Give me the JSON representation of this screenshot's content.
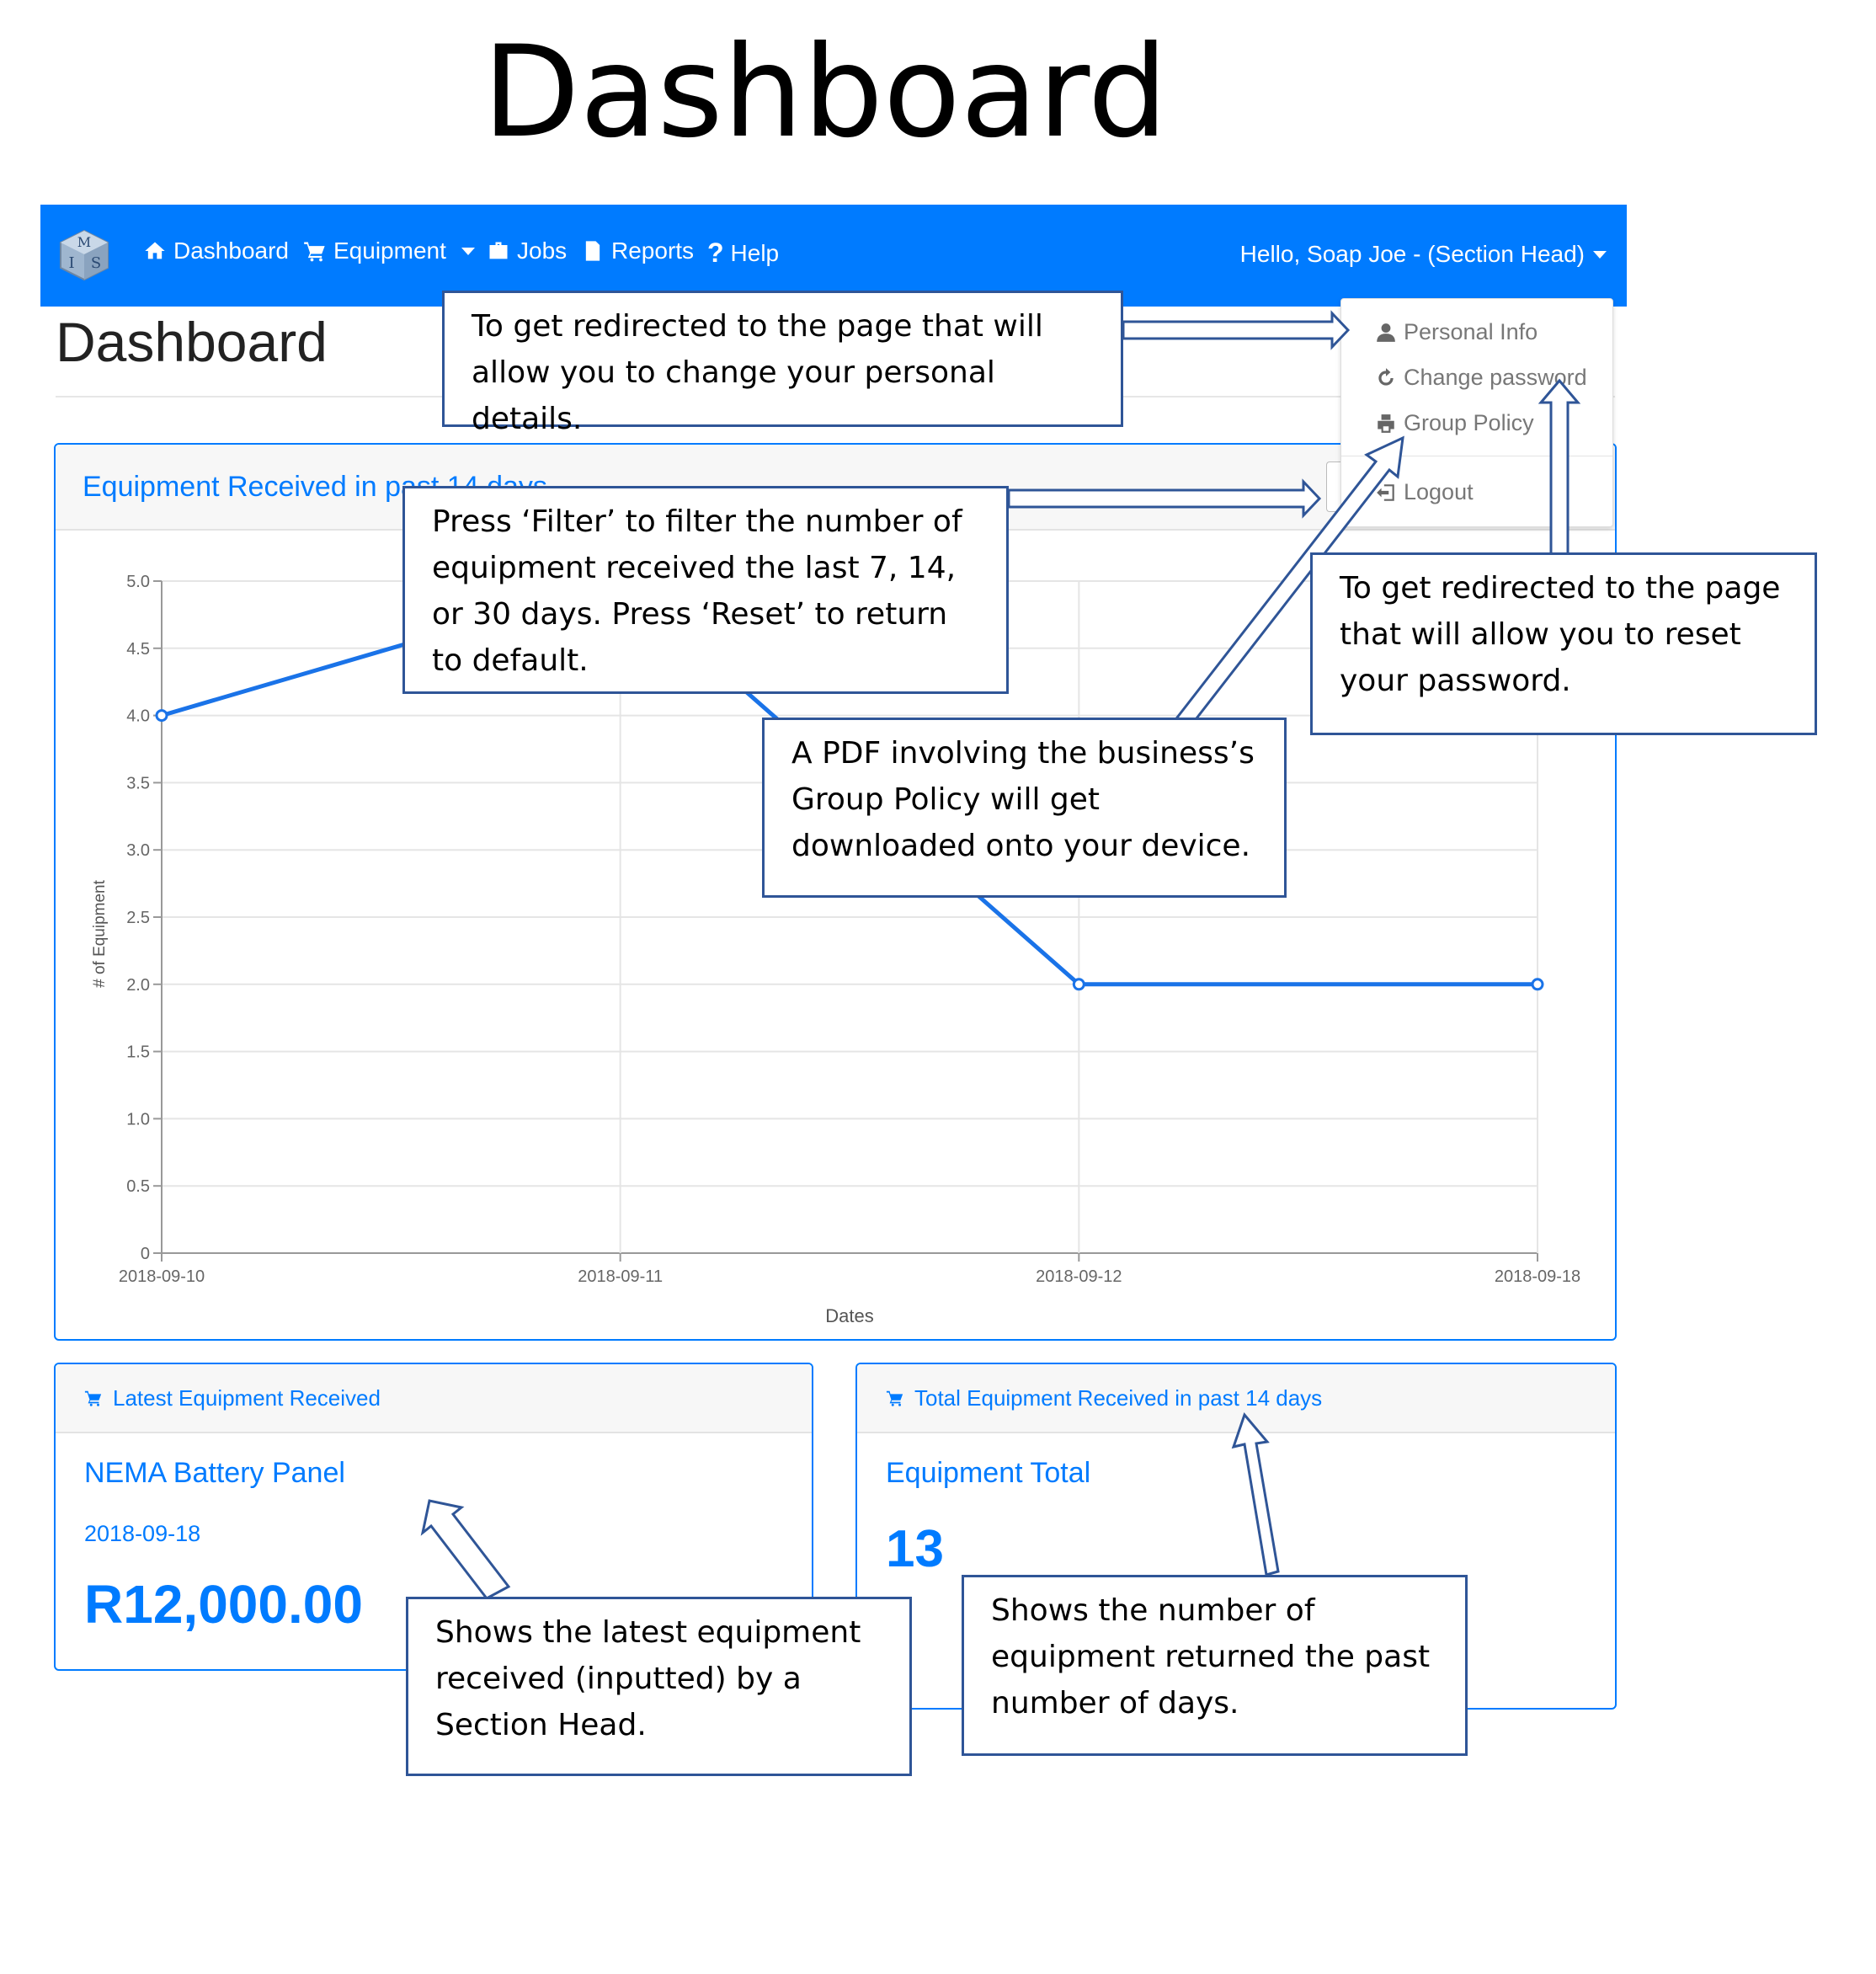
{
  "document_title": "Dashboard",
  "navbar": {
    "logo_letters": [
      "M",
      "I",
      "S"
    ],
    "items": [
      {
        "label": "Dashboard",
        "icon": "home-icon"
      },
      {
        "label": "Equipment",
        "icon": "cart-icon"
      },
      {
        "label": "Jobs",
        "icon": "briefcase-icon"
      },
      {
        "label": "Reports",
        "icon": "report-icon"
      },
      {
        "label": "Help",
        "icon": "question-icon"
      }
    ],
    "user_greeting": "Hello, Soap Joe - (Section Head)",
    "color": "#007bff"
  },
  "page": {
    "heading": "Dashboard"
  },
  "user_dropdown": {
    "items": [
      {
        "label": "Personal Info",
        "icon": "user-icon"
      },
      {
        "label": "Change password",
        "icon": "refresh-icon"
      },
      {
        "label": "Group Policy",
        "icon": "print-icon"
      },
      {
        "label": "Logout",
        "icon": "logout-icon"
      }
    ]
  },
  "equipment_chart": {
    "header": "Equipment Received in past 14 days"
  },
  "chart_data": {
    "type": "line",
    "categories": [
      "2018-09-10",
      "2018-09-11",
      "2018-09-12",
      "2018-09-18"
    ],
    "series": [
      {
        "values": [
          4,
          5,
          2,
          2
        ]
      }
    ],
    "ylim": [
      0,
      5
    ],
    "yticks": [
      "0",
      "0.5",
      "1.0",
      "1.5",
      "2.0",
      "2.5",
      "3.0",
      "3.5",
      "4.0",
      "4.5",
      "5.0"
    ],
    "xlabel": "Dates",
    "ylabel": "# of Equipment",
    "grid": true,
    "color": "#1a73e8"
  },
  "latest_card": {
    "header": "Latest Equipment Received",
    "icon": "cart-icon",
    "name": "NEMA Battery Panel",
    "date": "2018-09-18",
    "price": "R12,000.00"
  },
  "total_card": {
    "header": "Total Equipment Received in past 14 days",
    "icon": "cart-icon",
    "title": "Equipment Total",
    "count": "13"
  },
  "callouts": {
    "personal_info": "To get redirected to the page that will allow you to change your personal details.",
    "filter": "Press ‘Filter’ to filter the number of equipment received the last 7, 14, or 30 days. Press ‘Reset’ to return to default.",
    "change_password": "To get redirected to the page that will allow you to reset your password.",
    "group_policy": "A PDF involving the business’s Group Policy will get downloaded onto your device.",
    "latest_equipment": "Shows the latest equipment received (inputted) by a Section Head.",
    "total_equipment": "Shows the number of equipment returned the past number of days."
  },
  "callout_border_color": "#2f5597"
}
